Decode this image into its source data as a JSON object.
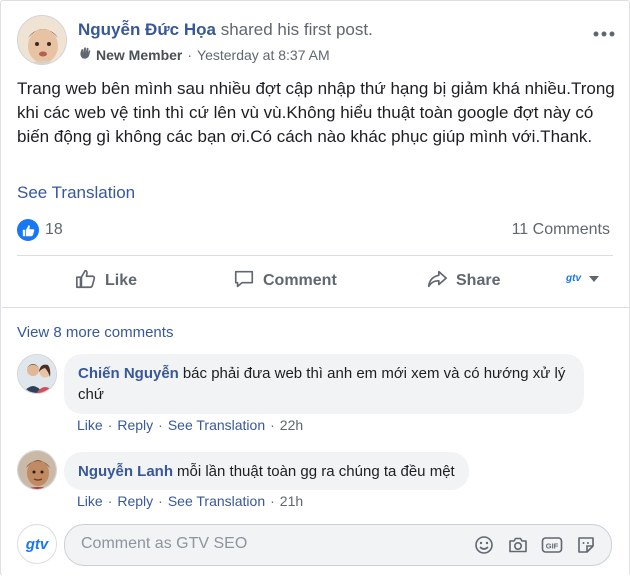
{
  "post": {
    "author": "Nguyễn Đức Họa",
    "action": "shared his first post.",
    "badge": "New Member",
    "timestamp": "Yesterday at 8:37 AM",
    "text": "Trang web bên mình sau nhiều đợt cập nhập thứ hạng bị giảm khá nhiều.Trong khi các web vệ tinh thì cứ lên vù vù.Không hiểu thuật toàn google đợt này có biến động gì không các bạn ơi.Có cách nào khác phục giúp mình với.Thank.",
    "see_translation": "See Translation",
    "reaction_count": "18",
    "comments_count": "11 Comments"
  },
  "actions": {
    "like": "Like",
    "comment": "Comment",
    "share": "Share",
    "audience_label": "gtv"
  },
  "comments_section": {
    "view_more": "View 8 more comments",
    "comments": [
      {
        "name": "Chiến Nguyễn",
        "text": "bác phải đưa web thì anh em mới xem và có hướng xử lý chứ",
        "like": "Like",
        "reply": "Reply",
        "see_translation": "See Translation",
        "time": "22h"
      },
      {
        "name": "Nguyễn Lanh",
        "text": "mỗi lần thuật toàn gg ra chúng ta đều mệt",
        "like": "Like",
        "reply": "Reply",
        "see_translation": "See Translation",
        "time": "21h"
      }
    ],
    "composer": {
      "avatar_label": "gtv",
      "placeholder": "Comment as GTV SEO"
    }
  },
  "icons": {
    "more": "more-options-icon",
    "member_badge": "hand-wave-icon",
    "like_reaction": "thumbs-up-icon",
    "composer": [
      "emoji-icon",
      "camera-icon",
      "gif-icon",
      "sticker-icon"
    ]
  },
  "colors": {
    "link": "#385898",
    "secondary": "#606770",
    "accent": "#1877f2",
    "bubble": "#f2f3f5"
  }
}
